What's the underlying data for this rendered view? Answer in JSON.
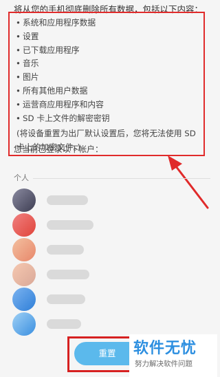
{
  "intro": "将从您的手机彻底删除所有数据，包括以下内容：",
  "data_items": [
    {
      "bullet": "•",
      "label": "系统和应用程序数据"
    },
    {
      "bullet": "•",
      "label": "设置"
    },
    {
      "bullet": "•",
      "label": "已下载应用程序"
    },
    {
      "bullet": "•",
      "label": "音乐"
    },
    {
      "bullet": "•",
      "label": "图片"
    },
    {
      "bullet": "•",
      "label": "所有其他用户数据"
    },
    {
      "bullet": "•",
      "label": "运营商应用程序和内容"
    },
    {
      "bullet": "•",
      "label": "SD 卡上文件的解密密钥"
    }
  ],
  "note": "(将设备重置为出厂默认设置后，您将无法使用 SD 卡上的加密文件。)",
  "logged_in_label": "您当前已登录以下帐户：",
  "section_header": "个人",
  "reset_button": "重置",
  "watermark": {
    "brand": "软件无忧",
    "slogan": "努力解决软件问题"
  },
  "colors": {
    "annotation_red": "#e02a2a",
    "button_blue": "#5bb9ec",
    "brand_blue": "#2d8fe0"
  }
}
